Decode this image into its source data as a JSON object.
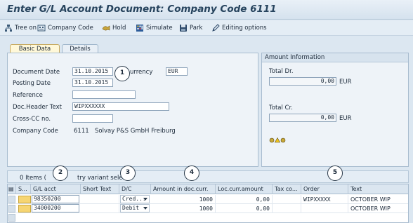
{
  "window": {
    "title": "Enter G/L Account Document: Company Code 6111"
  },
  "toolbar": {
    "items": [
      {
        "label": "Tree on",
        "icon": "tree-icon"
      },
      {
        "label": "Company Code",
        "icon": "company-code-icon"
      },
      {
        "label": "Hold",
        "icon": "hold-icon"
      },
      {
        "label": "Simulate",
        "icon": "simulate-icon"
      },
      {
        "label": "Park",
        "icon": "park-icon"
      },
      {
        "label": "Editing options",
        "icon": "pencil-icon"
      }
    ]
  },
  "tabs": [
    {
      "label": "Basic Data",
      "active": true
    },
    {
      "label": "Details",
      "active": false
    }
  ],
  "header_form": {
    "document_date": {
      "label": "Document Date",
      "value": "31.10.2015"
    },
    "currency": {
      "label": "urrency",
      "value": "EUR"
    },
    "posting_date": {
      "label": "Posting Date",
      "value": "31.10.2015"
    },
    "reference": {
      "label": "Reference",
      "value": ""
    },
    "doc_header_text": {
      "label": "Doc.Header Text",
      "value": "WIPXXXXXX"
    },
    "cross_cc": {
      "label": "Cross-CC no.",
      "value": ""
    },
    "company_code": {
      "label": "Company Code",
      "code": "6111",
      "name": "Solvay P&S GmbH Freiburg"
    }
  },
  "amount_info": {
    "title": "Amount Information",
    "total_dr": {
      "label": "Total Dr.",
      "value": "0,00",
      "currency": "EUR"
    },
    "total_cr": {
      "label": "Total Cr.",
      "value": "0,00",
      "currency": "EUR"
    },
    "status_icon": "traffic-light-icon"
  },
  "grid": {
    "status_left": "0 Items (",
    "status_right": "try variant selecte",
    "columns": [
      "S...",
      "G/L acct",
      "Short Text",
      "D/C",
      "Amount in doc.curr.",
      "Loc.curr.amount",
      "Tax co...",
      "Order",
      "Text"
    ],
    "rows": [
      {
        "gl_acct": "98350200",
        "short_text": "",
        "dc": "Cred...",
        "amount": "1000",
        "loc_amount": "0,00",
        "tax": "",
        "order": "WIPXXXXX",
        "text": "OCTOBER WIP"
      },
      {
        "gl_acct": "34000200",
        "short_text": "",
        "dc": "Debit",
        "amount": "1000",
        "loc_amount": "0,00",
        "tax": "",
        "order": "",
        "text": "OCTOBER WIP"
      }
    ]
  },
  "callouts": [
    "1",
    "2",
    "3",
    "4",
    "5"
  ],
  "colors": {
    "title_text": "#27445e",
    "active_tab": "#fff8d8",
    "status_cell": "#f6d572"
  }
}
